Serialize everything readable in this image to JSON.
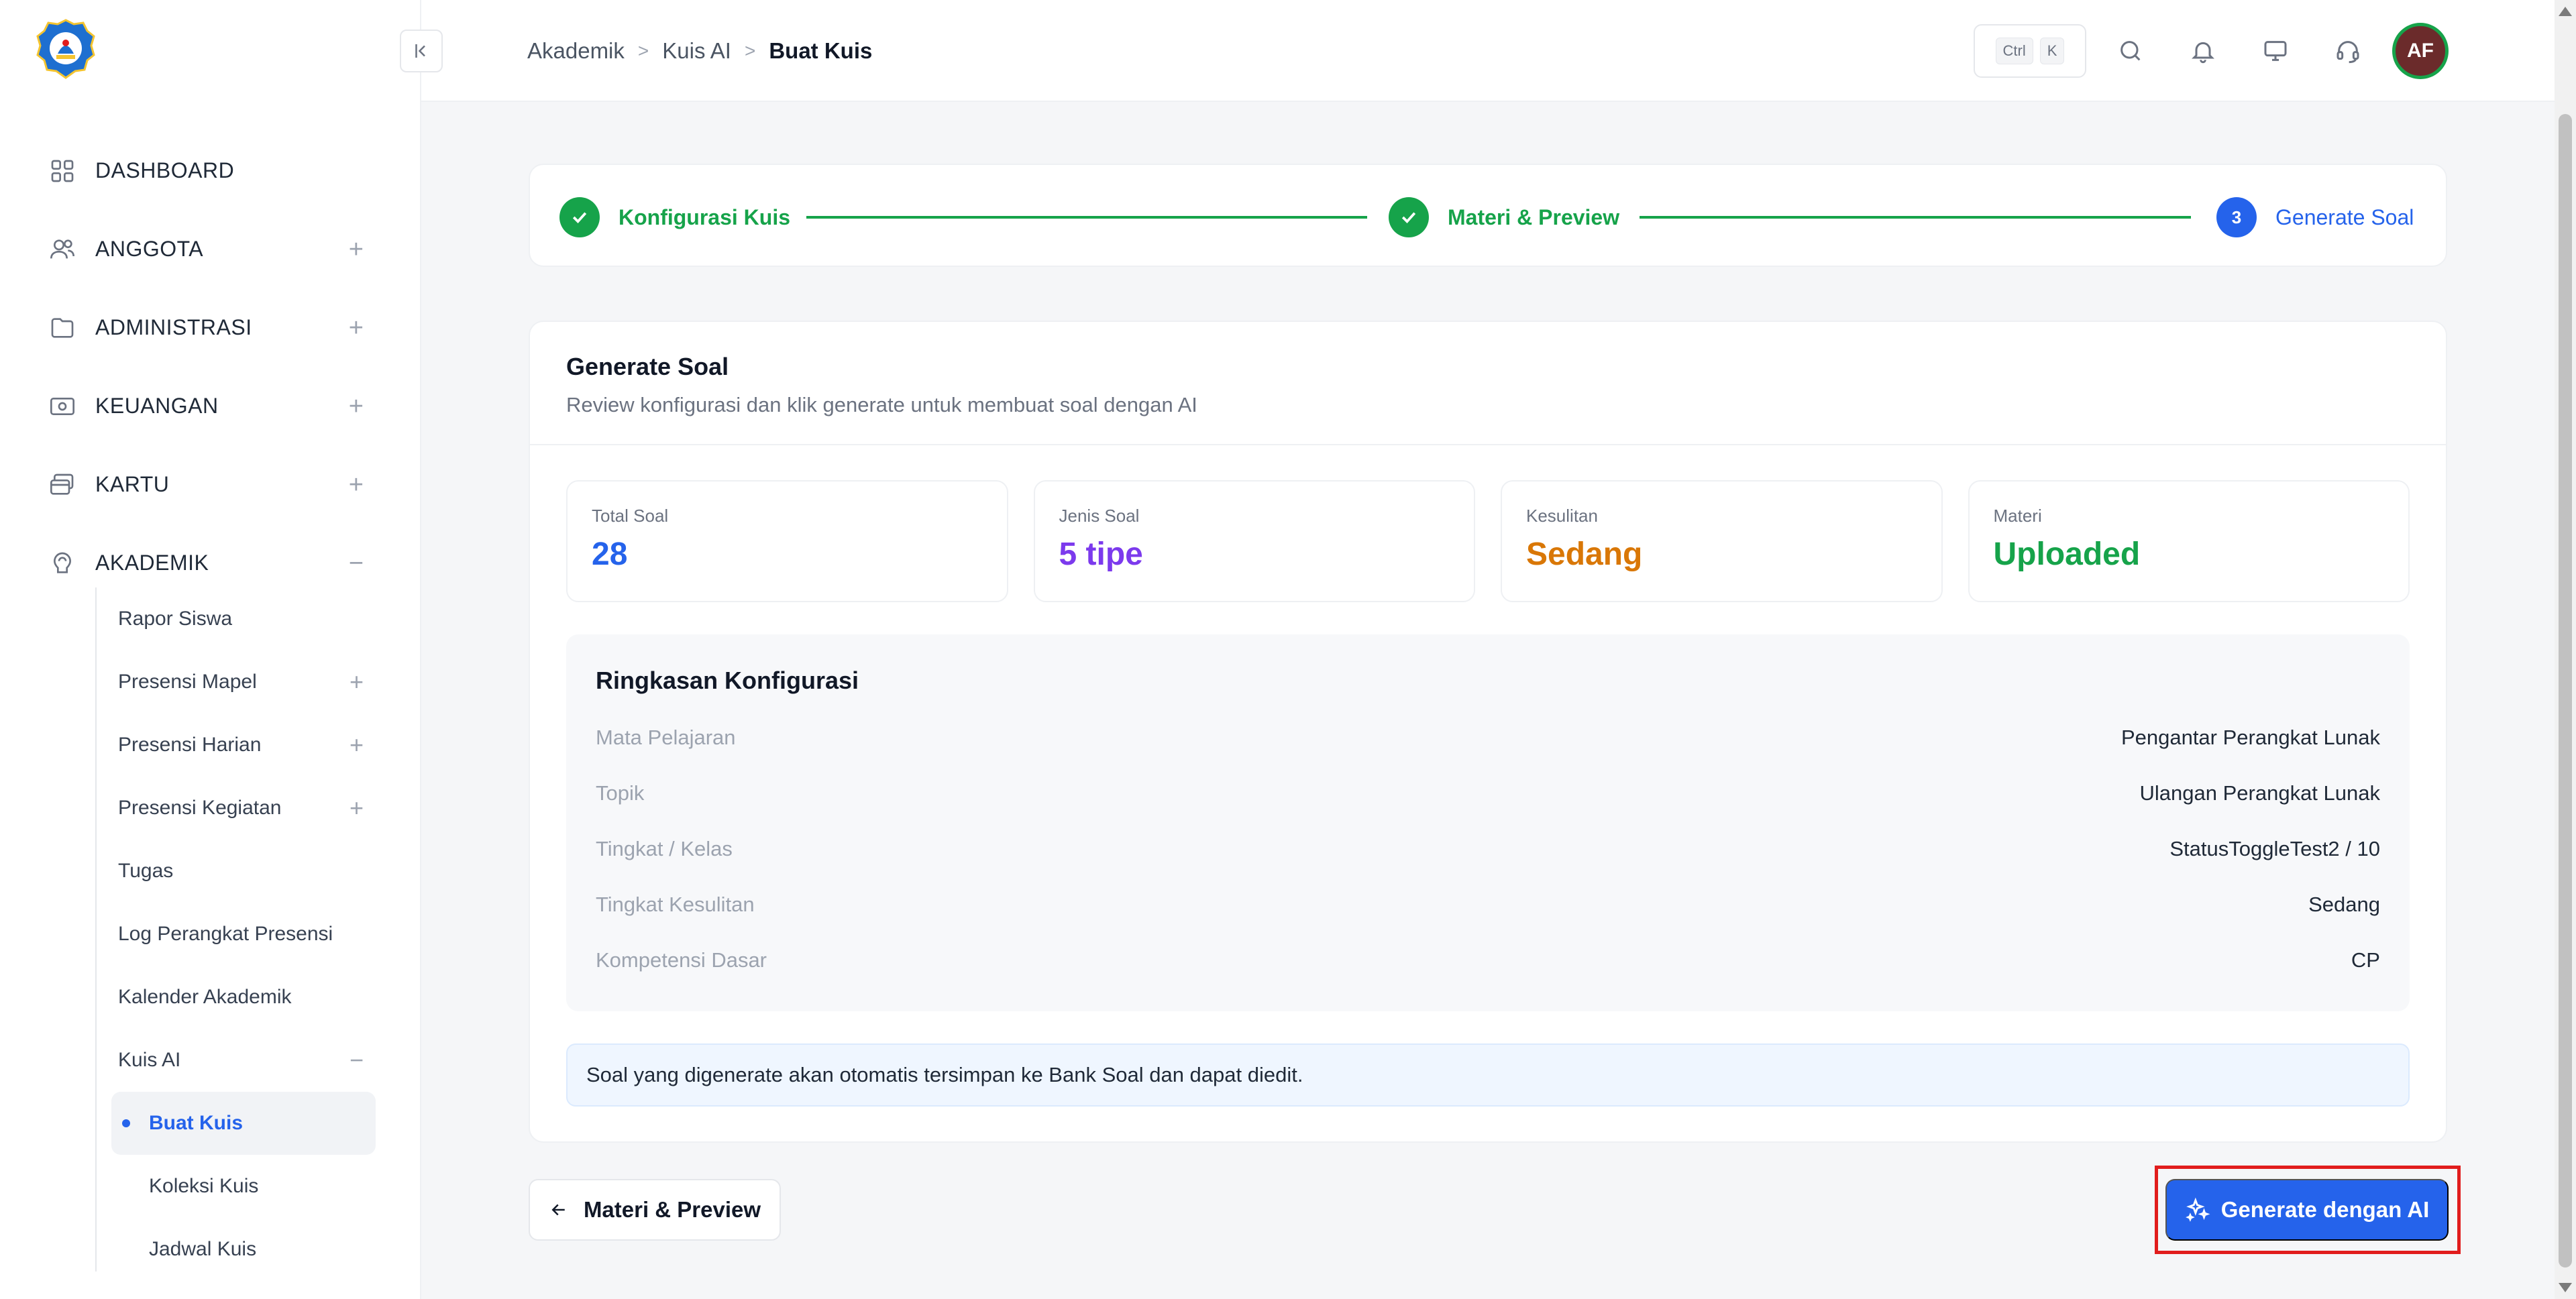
{
  "colors": {
    "primary": "#2563eb",
    "success": "#16a34a",
    "purple": "#7c3aed",
    "amber": "#d97706",
    "highlight": "#e11d1d"
  },
  "sidebar": {
    "nav": [
      {
        "label": "DASHBOARD",
        "icon": "grid-icon",
        "toggle": ""
      },
      {
        "label": "ANGGOTA",
        "icon": "users-icon",
        "toggle": "+"
      },
      {
        "label": "ADMINISTRASI",
        "icon": "folder-icon",
        "toggle": "+"
      },
      {
        "label": "KEUANGAN",
        "icon": "money-icon",
        "toggle": "+"
      },
      {
        "label": "KARTU",
        "icon": "card-icon",
        "toggle": "+"
      },
      {
        "label": "AKADEMIK",
        "icon": "brain-icon",
        "toggle": "−"
      }
    ],
    "sub": [
      {
        "label": "Rapor Siswa",
        "toggle": ""
      },
      {
        "label": "Presensi Mapel",
        "toggle": "+"
      },
      {
        "label": "Presensi Harian",
        "toggle": "+"
      },
      {
        "label": "Presensi Kegiatan",
        "toggle": "+"
      },
      {
        "label": "Tugas",
        "toggle": ""
      },
      {
        "label": "Log Perangkat Presensi",
        "toggle": ""
      },
      {
        "label": "Kalender Akademik",
        "toggle": ""
      },
      {
        "label": "Kuis AI",
        "toggle": "−"
      }
    ],
    "subsub": [
      {
        "label": "Buat Kuis",
        "active": true
      },
      {
        "label": "Koleksi Kuis",
        "active": false
      },
      {
        "label": "Jadwal Kuis",
        "active": false
      }
    ]
  },
  "topbar": {
    "breadcrumb": [
      "Akademik",
      "Kuis AI",
      "Buat Kuis"
    ],
    "shortcut": [
      "Ctrl",
      "K"
    ],
    "avatar_initials": "AF"
  },
  "stepper": [
    {
      "number": "",
      "label": "Konfigurasi Kuis",
      "state": "done"
    },
    {
      "number": "",
      "label": "Materi & Preview",
      "state": "done"
    },
    {
      "number": "3",
      "label": "Generate Soal",
      "state": "current"
    }
  ],
  "card": {
    "title": "Generate Soal",
    "subtitle": "Review konfigurasi dan klik generate untuk membuat soal dengan AI",
    "stats": [
      {
        "label": "Total Soal",
        "value": "28",
        "color": "#2563eb"
      },
      {
        "label": "Jenis Soal",
        "value": "5 tipe",
        "color": "#7c3aed"
      },
      {
        "label": "Kesulitan",
        "value": "Sedang",
        "color": "#d97706"
      },
      {
        "label": "Materi",
        "value": "Uploaded",
        "color": "#16a34a"
      }
    ],
    "summary": {
      "title": "Ringkasan Konfigurasi",
      "rows": [
        {
          "key": "Mata Pelajaran",
          "value": "Pengantar Perangkat Lunak"
        },
        {
          "key": "Topik",
          "value": "Ulangan Perangkat Lunak"
        },
        {
          "key": "Tingkat / Kelas",
          "value": "StatusToggleTest2 / 10"
        },
        {
          "key": "Tingkat Kesulitan",
          "value": "Sedang"
        },
        {
          "key": "Kompetensi Dasar",
          "value": "CP"
        }
      ]
    },
    "info": "Soal yang digenerate akan otomatis tersimpan ke Bank Soal dan dapat diedit."
  },
  "actions": {
    "back_label": "Materi & Preview",
    "generate_label": "Generate dengan AI"
  }
}
